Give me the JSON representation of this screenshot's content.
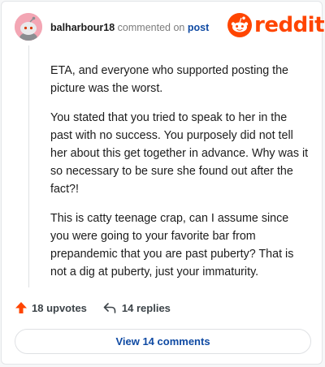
{
  "header": {
    "username": "balharbour18",
    "action_text": "commented on",
    "post_link": "post"
  },
  "brand": {
    "wordmark": "reddit",
    "color": "#ff4500"
  },
  "comment": {
    "paragraphs": [
      "ETA, and everyone who supported posting the picture was the worst.",
      "You stated that you tried to speak to her in the past with no success. You purposely did not tell her about this get together in advance. Why was it so necessary to be sure she found out after the fact?!",
      "This is catty teenage crap, can I assume since you were going to your favorite bar from prepandemic that you are past puberty? That is not a dig at puberty, just your immaturity."
    ]
  },
  "actions": {
    "upvotes": "18 upvotes",
    "replies": "14 replies",
    "upvote_icon": "upvote-arrow-icon",
    "reply_icon": "reply-arrow-icon"
  },
  "footer": {
    "view_comments": "View 14 comments"
  },
  "colors": {
    "accent": "#ff4500",
    "link": "#0f4aa3",
    "avatar_bg": "#f3a6b4"
  }
}
